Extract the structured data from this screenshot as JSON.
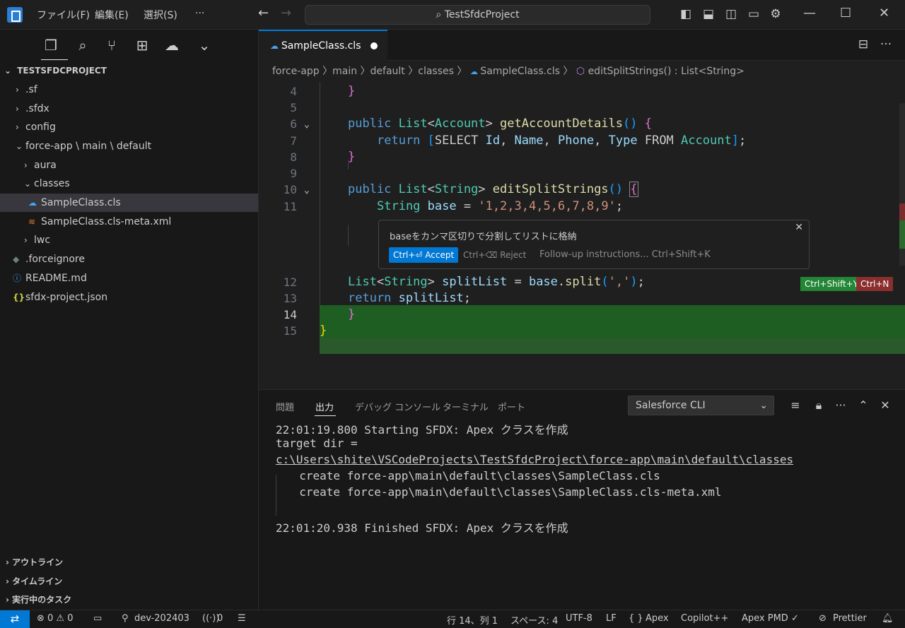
{
  "titlebar": {
    "menu": [
      "ファイル(F)",
      "編集(E)",
      "選択(S)",
      "···"
    ],
    "search": "TestSfdcProject"
  },
  "sidebar": {
    "project_title": "TESTSFDCPROJECT",
    "tree": [
      {
        "label": ".sf",
        "kind": "folder",
        "expanded": false
      },
      {
        "label": ".sfdx",
        "kind": "folder",
        "expanded": false
      },
      {
        "label": "config",
        "kind": "folder",
        "expanded": false
      },
      {
        "label": "force-app \\ main \\ default",
        "kind": "folder",
        "expanded": true
      },
      {
        "label": "aura",
        "kind": "folder",
        "expanded": false
      },
      {
        "label": "classes",
        "kind": "folder",
        "expanded": true
      },
      {
        "label": "SampleClass.cls",
        "kind": "apex",
        "selected": true
      },
      {
        "label": "SampleClass.cls-meta.xml",
        "kind": "xml"
      },
      {
        "label": "lwc",
        "kind": "folder",
        "expanded": false
      },
      {
        "label": ".forceignore",
        "kind": "file"
      },
      {
        "label": "README.md",
        "kind": "info"
      },
      {
        "label": "sfdx-project.json",
        "kind": "json"
      }
    ],
    "bottom_sections": [
      "アウトライン",
      "タイムライン",
      "実行中のタスク"
    ]
  },
  "editor": {
    "tab_label": "SampleClass.cls",
    "breadcrumb": "force-app 〉main 〉default 〉classes 〉",
    "breadcrumb_file": "SampleClass.cls",
    "breadcrumb_symbol": "editSplitStrings() : List<String>",
    "line_numbers": [
      "4",
      "5",
      "6",
      "7",
      "8",
      "9",
      "10",
      "11",
      "12",
      "13",
      "14",
      "15"
    ],
    "chat": {
      "prompt": "baseをカンマ区切りで分割してリストに格納",
      "accept": "Ctrl+⏎ Accept",
      "reject": "Ctrl+⌫ Reject",
      "followup": "Follow-up instructions... Ctrl+Shift+K"
    },
    "kb_accept": "Ctrl+Shift+Y",
    "kb_reject": "Ctrl+N"
  },
  "panel": {
    "tabs": [
      "問題",
      "出力",
      "デバッグ コンソール",
      "ターミナル",
      "ポート"
    ],
    "channel": "Salesforce CLI",
    "output": [
      "22:01:19.800 Starting SFDX: Apex クラスを作成",
      "target dir =",
      "c:\\Users\\shite\\VSCodeProjects\\TestSfdcProject\\force-app\\main\\default\\classes",
      "  create force-app\\main\\default\\classes\\SampleClass.cls",
      "  create force-app\\main\\default\\classes\\SampleClass.cls-meta.xml",
      "",
      "22:01:20.938 Finished SFDX: Apex クラスを作成"
    ]
  },
  "statusbar": {
    "problems": "⊗ 0 ⚠ 0",
    "branch": "dev-202403",
    "ports": "0",
    "position": "行 14、列 1",
    "spaces": "スペース: 4",
    "encoding": "UTF-8",
    "eol": "LF",
    "language": "Apex",
    "copilot": "Copilot++",
    "pmd": "Apex PMD ✓",
    "prettier": "Prettier"
  },
  "colors": {
    "accent": "#0078d4",
    "added_bg": "#1f5e22",
    "accept": "#238636",
    "reject": "#8b2e2e"
  }
}
